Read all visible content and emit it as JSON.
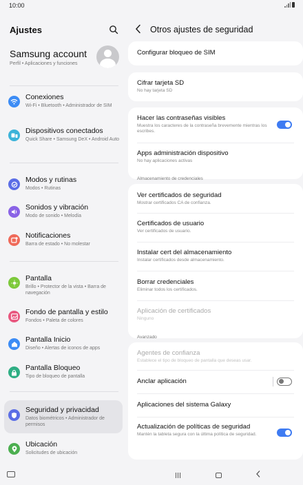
{
  "status_bar": {
    "time": "10:00"
  },
  "settings": {
    "title": "Ajustes",
    "account": {
      "name": "Samsung account",
      "subtitle": "Perfil • Aplicaciones y funciones"
    },
    "items": [
      {
        "title": "Conexiones",
        "subtitle": "Wi-Fi • Bluetooth • Administrador de SIM",
        "icon": "wifi-icon",
        "color": "#3c8cf5"
      },
      {
        "title": "Dispositivos conectados",
        "subtitle": "Quick Share • Samsung DeX • Android Auto",
        "icon": "connected-devices-icon",
        "color": "#3cb3d9"
      },
      {
        "title": "Modos y rutinas",
        "subtitle": "Modos • Rutinas",
        "icon": "modes-icon",
        "color": "#5b6ee6"
      },
      {
        "title": "Sonidos y vibración",
        "subtitle": "Modo de sonido • Melodía",
        "icon": "sound-icon",
        "color": "#8a63e6"
      },
      {
        "title": "Notificaciones",
        "subtitle": "Barra de estado • No molestar",
        "icon": "notifications-icon",
        "color": "#ef6a5a"
      },
      {
        "title": "Pantalla",
        "subtitle": "Brillo • Protector de la vista • Barra de navegación",
        "icon": "display-icon",
        "color": "#7dc93b"
      },
      {
        "title": "Fondo de pantalla y estilo",
        "subtitle": "Fondos • Paleta de colores",
        "icon": "wallpaper-icon",
        "color": "#e8577f"
      },
      {
        "title": "Pantalla Inicio",
        "subtitle": "Diseño • Alertas de iconos de apps",
        "icon": "home-screen-icon",
        "color": "#3c8cf5"
      },
      {
        "title": "Pantalla Bloqueo",
        "subtitle": "Tipo de bloqueo de pantalla",
        "icon": "lock-screen-icon",
        "color": "#2fae84"
      },
      {
        "title": "Seguridad y privacidad",
        "subtitle": "Datos biométricos • Administrador de permisos",
        "icon": "security-icon",
        "color": "#5b6ee6"
      },
      {
        "title": "Ubicación",
        "subtitle": "Solicitudes de ubicación",
        "icon": "location-icon",
        "color": "#4caf50"
      }
    ]
  },
  "detail": {
    "title": "Otros ajustes de seguridad",
    "sim_lock": {
      "title": "Configurar bloqueo de SIM"
    },
    "sd_encrypt": {
      "title": "Cifrar tarjeta SD",
      "subtitle": "No hay tarjeta SD"
    },
    "passwords_visible": {
      "title": "Hacer las contraseñas visibles",
      "subtitle": "Muestra los caracteres de la contraseña brevemente mientras los escribes.",
      "on": true
    },
    "device_admin": {
      "title": "Apps administración dispositivo",
      "subtitle": "No hay aplicaciones activas"
    },
    "credentials_header": "Almacenamiento de credenciales",
    "view_certs": {
      "title": "Ver certificados de seguridad",
      "subtitle": "Mostrar certificados CA de confianza."
    },
    "user_certs": {
      "title": "Certificados de usuario",
      "subtitle": "Ver certificados de usuario."
    },
    "install_cert": {
      "title": "Instalar cert del almacenamiento",
      "subtitle": "Instalar certificados desde almacenamiento."
    },
    "clear_creds": {
      "title": "Borrar credenciales",
      "subtitle": "Eliminar todos los certificados."
    },
    "cert_app": {
      "title": "Aplicación de certificados",
      "subtitle": "Ninguno"
    },
    "advanced_header": "Avanzado",
    "trust_agents": {
      "title": "Agentes de confianza",
      "subtitle": "Establece el tipo de bloqueo de pantalla que deseas usar."
    },
    "pin_app": {
      "title": "Anclar aplicación",
      "on": false
    },
    "galaxy_system_apps": {
      "title": "Aplicaciones del sistema Galaxy"
    },
    "policy_updates": {
      "title": "Actualización de políticas de seguridad",
      "subtitle": "Mantén la tableta segura con la última política de seguridad.",
      "on": true
    }
  }
}
